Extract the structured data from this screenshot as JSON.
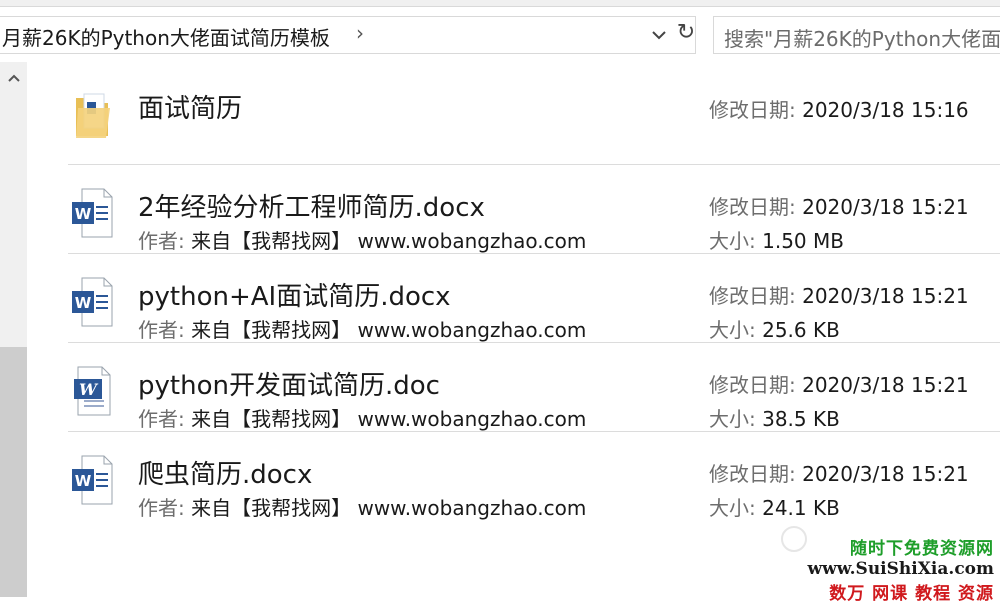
{
  "address": {
    "path": "月薪26K的Python大佬面试简历模板"
  },
  "search": {
    "placeholder": "搜索\"月薪26K的Python大佬面"
  },
  "labels": {
    "modified": "修改日期:",
    "size": "大小:",
    "author": "作者:"
  },
  "items": [
    {
      "type": "folder",
      "icon": "folder-icon",
      "name": "面试简历",
      "modified": "2020/3/18 15:16"
    },
    {
      "type": "file",
      "icon": "word-document-icon",
      "name": "2年经验分析工程师简历.docx",
      "author": "来自【我帮找网】 www.wobangzhao.com",
      "modified": "2020/3/18 15:21",
      "size": "1.50 MB"
    },
    {
      "type": "file",
      "icon": "word-document-icon",
      "name": "python+AI面试简历.docx",
      "author": "来自【我帮找网】 www.wobangzhao.com",
      "modified": "2020/3/18 15:21",
      "size": "25.6 KB"
    },
    {
      "type": "file",
      "icon": "word-legacy-document-icon",
      "name": "python开发面试简历.doc",
      "author": "来自【我帮找网】 www.wobangzhao.com",
      "modified": "2020/3/18 15:21",
      "size": "38.5 KB"
    },
    {
      "type": "file",
      "icon": "word-document-icon",
      "name": "爬虫简历.docx",
      "author": "来自【我帮找网】 www.wobangzhao.com",
      "modified": "2020/3/18 15:21",
      "size": "24.1 KB"
    }
  ],
  "watermark": {
    "line1": "随时下免费资源网",
    "line2": "www.SuiShiXia.com",
    "line3": "数万 网课 教程 资源"
  },
  "colors": {
    "word_blue": "#2b5797",
    "folder_yellow": "#f1d27a",
    "watermark_green": "#1e9e2a",
    "watermark_red": "#d0191d"
  }
}
